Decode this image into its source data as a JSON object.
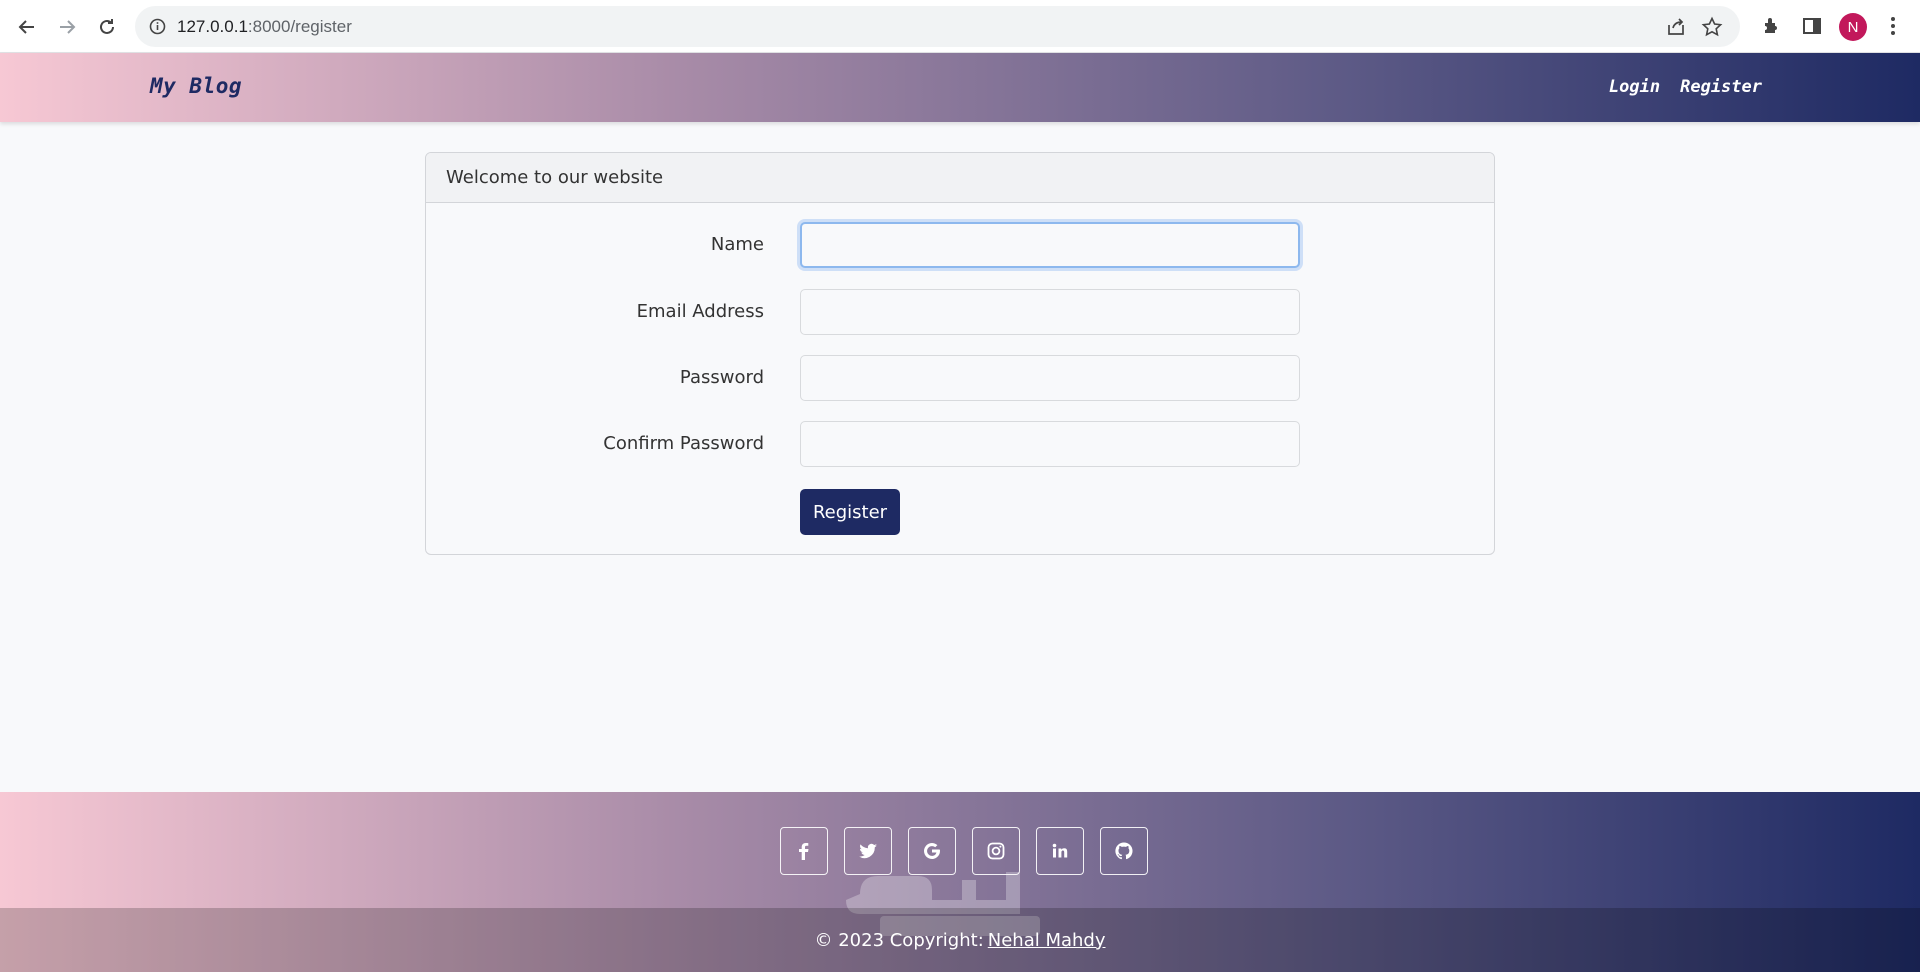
{
  "browser": {
    "url_host": "127.0.0.1",
    "url_path": ":8000/register",
    "profile_initial": "N"
  },
  "nav": {
    "brand": "My Blog",
    "links": [
      "Login",
      "Register"
    ]
  },
  "card": {
    "header": "Welcome to our website",
    "fields": [
      {
        "label": "Name",
        "value": ""
      },
      {
        "label": "Email Address",
        "value": ""
      },
      {
        "label": "Password",
        "value": ""
      },
      {
        "label": "Confirm Password",
        "value": ""
      }
    ],
    "submit_label": "Register"
  },
  "footer": {
    "social_icons": [
      "facebook-icon",
      "twitter-icon",
      "google-icon",
      "instagram-icon",
      "linkedin-icon",
      "github-icon"
    ],
    "copyright_prefix": "© 2023 Copyright:",
    "author": "Nehal Mahdy"
  },
  "colors": {
    "brand_navy": "#1e2a63",
    "gradient_start": "#f7c8d4",
    "focus_ring": "#8db8ee"
  }
}
